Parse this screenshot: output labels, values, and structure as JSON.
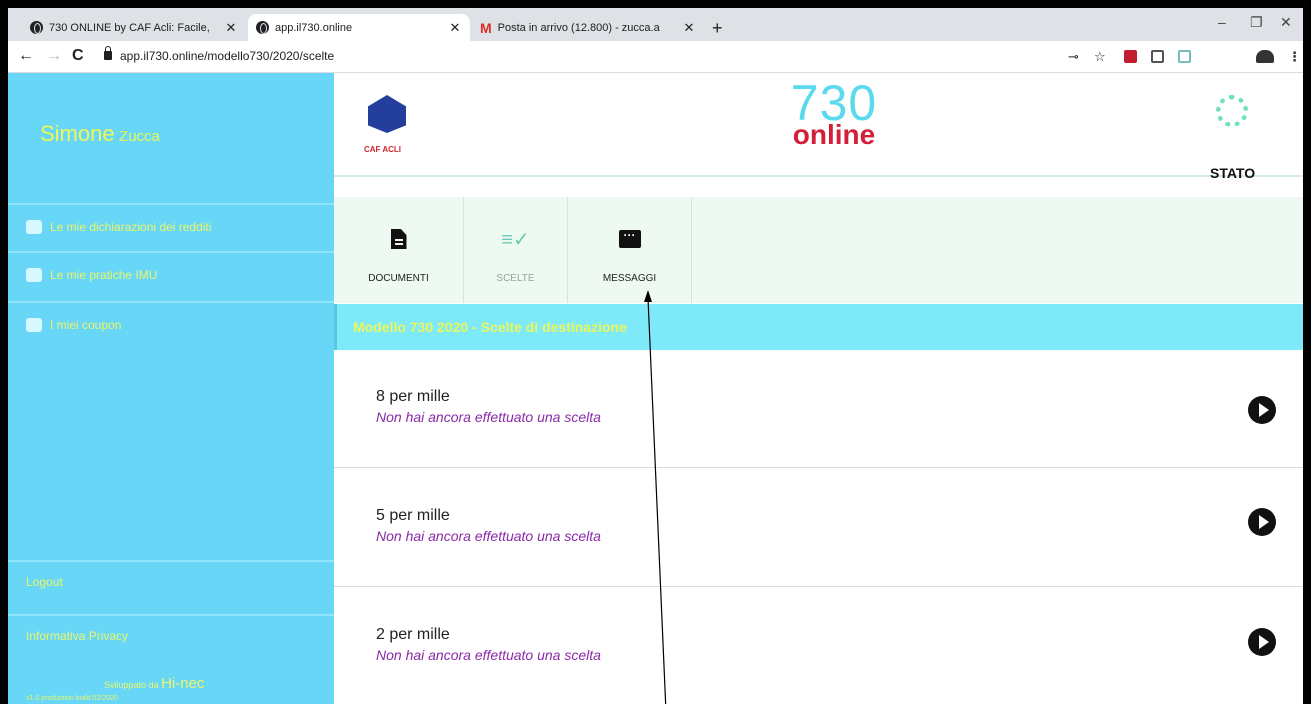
{
  "browser": {
    "tabs": [
      {
        "title": "730 ONLINE by CAF Acli: Facile,",
        "icon": "globe-icon"
      },
      {
        "title": "app.il730.online",
        "icon": "globe-icon"
      },
      {
        "title": "Posta in arrivo (12.800) - zucca.a",
        "icon": "gmail-icon"
      }
    ],
    "new_tab": "+",
    "url": "app.il730.online/modello730/2020/scelte",
    "window_controls": [
      "–",
      "❐",
      "✕"
    ]
  },
  "sidebar": {
    "first_name": "Simone",
    "last_name": "Zucca",
    "items": [
      {
        "label": "Le mie dichiarazioni dei redditi",
        "icon": "document-icon"
      },
      {
        "label": "Le mie pratiche IMU",
        "icon": "home-icon"
      },
      {
        "label": "I miei coupon",
        "icon": "tag-icon"
      }
    ],
    "logout": "Logout",
    "privacy": "Informativa Privacy",
    "developed_by": "Sviluppato da",
    "developer": "Hi-nec",
    "version": "v1.0 production build 02/2020"
  },
  "header": {
    "logo_text": "CAF ACLI",
    "brand_number": "730",
    "brand_word": "online",
    "status_label": "STATO"
  },
  "menu": {
    "items": [
      {
        "label": "DOCUMENTI",
        "icon": "document-icon"
      },
      {
        "label": "SCELTE",
        "icon": "checklist-icon"
      },
      {
        "label": "MESSAGGI",
        "icon": "message-icon"
      }
    ]
  },
  "banner": {
    "title": "Modello 730 2020 - Scelte di destinazione"
  },
  "choices": [
    {
      "title": "8 per mille",
      "subtitle": "Non hai ancora effettuato una scelta"
    },
    {
      "title": "5 per mille",
      "subtitle": "Non hai ancora effettuato una scelta"
    },
    {
      "title": "2 per mille",
      "subtitle": "Non hai ancora effettuato una scelta"
    }
  ],
  "colors": {
    "sidebar": "#68d6f7",
    "sidebar_text": "#e9f66a",
    "banner": "#7eeaf9",
    "brand_blue": "#5bd9ee",
    "brand_red": "#d41f3a",
    "subtitle": "#8a2aa8"
  }
}
